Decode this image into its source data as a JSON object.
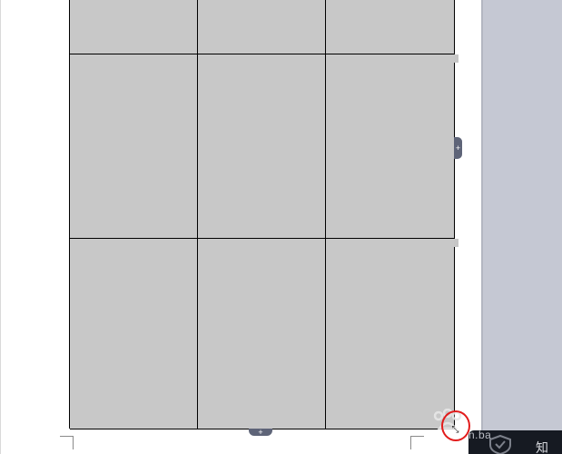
{
  "document": {
    "table": {
      "rows": 3,
      "columns": 3,
      "cell_fill": "#c8c8c8",
      "border_color": "#000000",
      "cells": [
        "",
        "",
        "",
        "",
        "",
        "",
        "",
        "",
        ""
      ]
    },
    "controls": {
      "row_insert_icon": "+",
      "column_insert_icon": "+",
      "resize_icon": "⤡"
    }
  },
  "colors": {
    "workspace": "#c5c8d3",
    "handle": "#5e6478",
    "annotation": "#e21b1b"
  },
  "watermark": {
    "text": "n.ba",
    "suffix": "知"
  }
}
